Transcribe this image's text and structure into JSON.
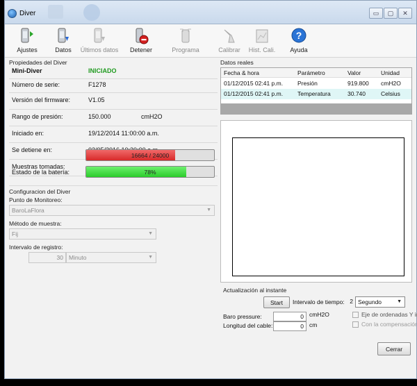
{
  "window": {
    "title": "Diver"
  },
  "toolbar": [
    {
      "key": "ajustes",
      "label": "Ajustes",
      "icon": "ajustes-icon",
      "enabled": true
    },
    {
      "key": "datos",
      "label": "Datos",
      "icon": "datos-icon",
      "enabled": true
    },
    {
      "key": "ultimos",
      "label": "Últimos datos",
      "icon": "ultimos-datos-icon",
      "enabled": false
    },
    {
      "key": "detener",
      "label": "Detener",
      "icon": "stop-icon",
      "enabled": true
    },
    {
      "key": "programa",
      "label": "Programa",
      "icon": "programa-icon",
      "enabled": false
    },
    {
      "key": "calibrar",
      "label": "Calibrar",
      "icon": "calibrar-icon",
      "enabled": false
    },
    {
      "key": "histcali",
      "label": "Hist. Cali.",
      "icon": "hist-cali-icon",
      "enabled": false
    },
    {
      "key": "ayuda",
      "label": "Ayuda",
      "icon": "help-icon",
      "enabled": true
    }
  ],
  "properties": {
    "group_title": "Propiedades del Diver",
    "device_name": "Mini-Diver",
    "status": "INICIADO",
    "rows": [
      {
        "label": "Número de serie:",
        "value": "F1278"
      },
      {
        "label": "Versión del firmware:",
        "value": "V1.05"
      },
      {
        "label": "Rango de presión:",
        "value": "150.000",
        "unit": "cmH2O"
      },
      {
        "label": "Iniciado en:",
        "value": "19/12/2014 11:00:00 a.m."
      },
      {
        "label": "Se detiene en:",
        "value": "02/05/2016 10:30:00 a.m."
      }
    ],
    "samples": {
      "label": "Muestras tomadas:",
      "text": "16664 / 24000",
      "fraction": 0.694
    },
    "battery": {
      "label": "Estado de la batería:",
      "text": "78%",
      "fraction": 0.78
    }
  },
  "config": {
    "group_title": "Configuracion del Diver",
    "point_label": "Punto de Monitoreo:",
    "point_value": "BaroLaFlora",
    "method_label": "Método de muestra:",
    "method_value": "Fij",
    "interval_label": "Intervalo de registro:",
    "interval_value": "30",
    "interval_unit": "Minuto"
  },
  "realtime": {
    "group_title": "Datos reales",
    "headers": [
      "Fecha & hora",
      "Parámetro",
      "Valor",
      "Unidad"
    ],
    "rows": [
      [
        "01/12/2015 02:41 p.m.",
        "Presión",
        "919.800",
        "cmH2O"
      ],
      [
        "01/12/2015 02:41 p.m.",
        "Temperatura",
        "30.740",
        "Celsius"
      ]
    ]
  },
  "update": {
    "group_title": "Actualización al instante",
    "start_label": "Start",
    "time_interval_label": "Intervalo de tiempo:",
    "time_interval_value": "2",
    "time_interval_unit": "Segundo",
    "baro_label": "Baro pressure:",
    "baro_value": "0",
    "baro_unit": "cmH2O",
    "cable_label": "Longitud del cable:",
    "cable_value": "0",
    "cable_unit": "cm",
    "axis_check_label": "Eje de ordenadas Y invertid",
    "comp_check_label": "Con la compensación"
  },
  "close_label": "Cerrar",
  "colors": {
    "samples_fill": "#e83a3a",
    "battery_fill": "#3ddc3d",
    "status": "#1f9a1f",
    "table_alt": "#dff6f6"
  }
}
